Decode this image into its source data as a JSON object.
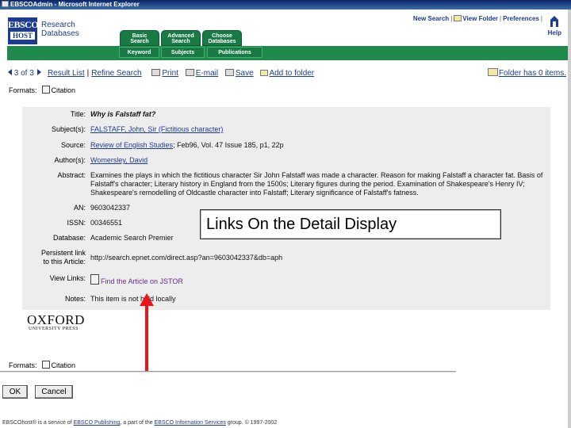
{
  "window": {
    "title": "EBSCOAdmin - Microsoft Internet Explorer"
  },
  "header": {
    "logo_line1": "EBSCO",
    "logo_line2": "HOST",
    "logo_text": [
      "Research",
      "Databases"
    ],
    "links": [
      "New Search",
      "View Folder",
      "Preferences",
      "Help"
    ],
    "tabs": [
      {
        "line1": "Basic",
        "line2": "Search"
      },
      {
        "line1": "Advanced",
        "line2": "Search"
      },
      {
        "line1": "Choose",
        "line2": "Databases"
      }
    ],
    "nav": [
      "Keyword",
      "Subjects",
      "Publications"
    ],
    "brand_color": "#1d3c8e",
    "nav_color": "#1f8a4c"
  },
  "toolbar": {
    "position": "3 of 3",
    "result_list": "Result List",
    "refine_search": "Refine Search",
    "print": "Print",
    "email": "E-mail",
    "save": "Save",
    "add_to_folder": "Add to folder",
    "folder_status": "Folder has 0 items."
  },
  "formats": {
    "label": "Formats:",
    "citation": "Citation"
  },
  "record": {
    "title_label": "Title:",
    "title": "Why is Falstaff fat?",
    "subjects_label": "Subject(s):",
    "subjects": "FALSTAFF, John, Sir (Fictitious character)",
    "source_label": "Source:",
    "source_link": "Review of English Studies",
    "source_rest": "; Feb96, Vol. 47 Issue 185, p1, 22p",
    "authors_label": "Author(s):",
    "authors": "Womersley, David",
    "abstract_label": "Abstract:",
    "abstract": "Examines the plays in which the fictitious character Sir John Falstaff was made a character. Reason for making Falstaff a character fat. Basis of Falstaff's character; Literary history in England from the 1500s; Literary figures during the period. Examination of Shakespeare's Henry IV; Shakespeare's remodelling of Oldcastle character into Falstaff; Literary significance of Falstaff's fatness.",
    "an_label": "AN:",
    "an": "9603042337",
    "issn_label": "ISSN:",
    "issn": "00346551",
    "database_label": "Database:",
    "database": "Academic Search Premier",
    "persistent_label1": "Persistent link",
    "persistent_label2": "to this Article:",
    "persistent": "http://search.epnet.com/direct.asp?an=9603042337&db=aph",
    "viewlinks_label": "View Links:",
    "viewlinks": "Find the Article on JSTOR",
    "notes_label": "Notes:",
    "notes": "This item is not held locally"
  },
  "publisher": {
    "name": "OXFORD",
    "sub": "UNIVERSITY PRESS"
  },
  "callout": "Links On the Detail Display",
  "buttons": {
    "ok": "OK",
    "cancel": "Cancel"
  },
  "footer": {
    "pre": "EBSCOhost® is a service of",
    "link1": "EBSCO Publishing",
    "mid": ", a part of the",
    "link2": "EBSCO Information Services",
    "post": "group. © 1997-2002"
  }
}
